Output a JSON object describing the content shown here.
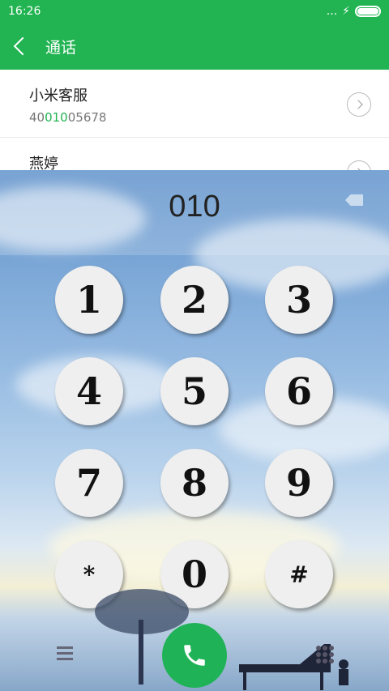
{
  "status_bar": {
    "time": "16:26",
    "signal_dots": "...",
    "charging_icon": "⚡"
  },
  "header": {
    "title": "通话"
  },
  "contacts": [
    {
      "name": "小米客服",
      "number_prefix": "40",
      "number_match": "010",
      "number_suffix": "05678"
    },
    {
      "name": "燕婷",
      "number_prefix": "",
      "number_match": "",
      "number_suffix": ""
    }
  ],
  "dialer": {
    "entered_number": "010",
    "keys": [
      "1",
      "2",
      "3",
      "4",
      "5",
      "6",
      "7",
      "8",
      "9",
      "*",
      "0",
      "#"
    ]
  },
  "colors": {
    "accent": "#22b452",
    "call_button": "#20b257"
  },
  "icons": {
    "back": "back-icon",
    "chevron": "chevron-right-icon",
    "backspace": "backspace-icon",
    "menu": "menu-icon",
    "call": "phone-icon",
    "keypad_toggle": "keypad-icon"
  }
}
